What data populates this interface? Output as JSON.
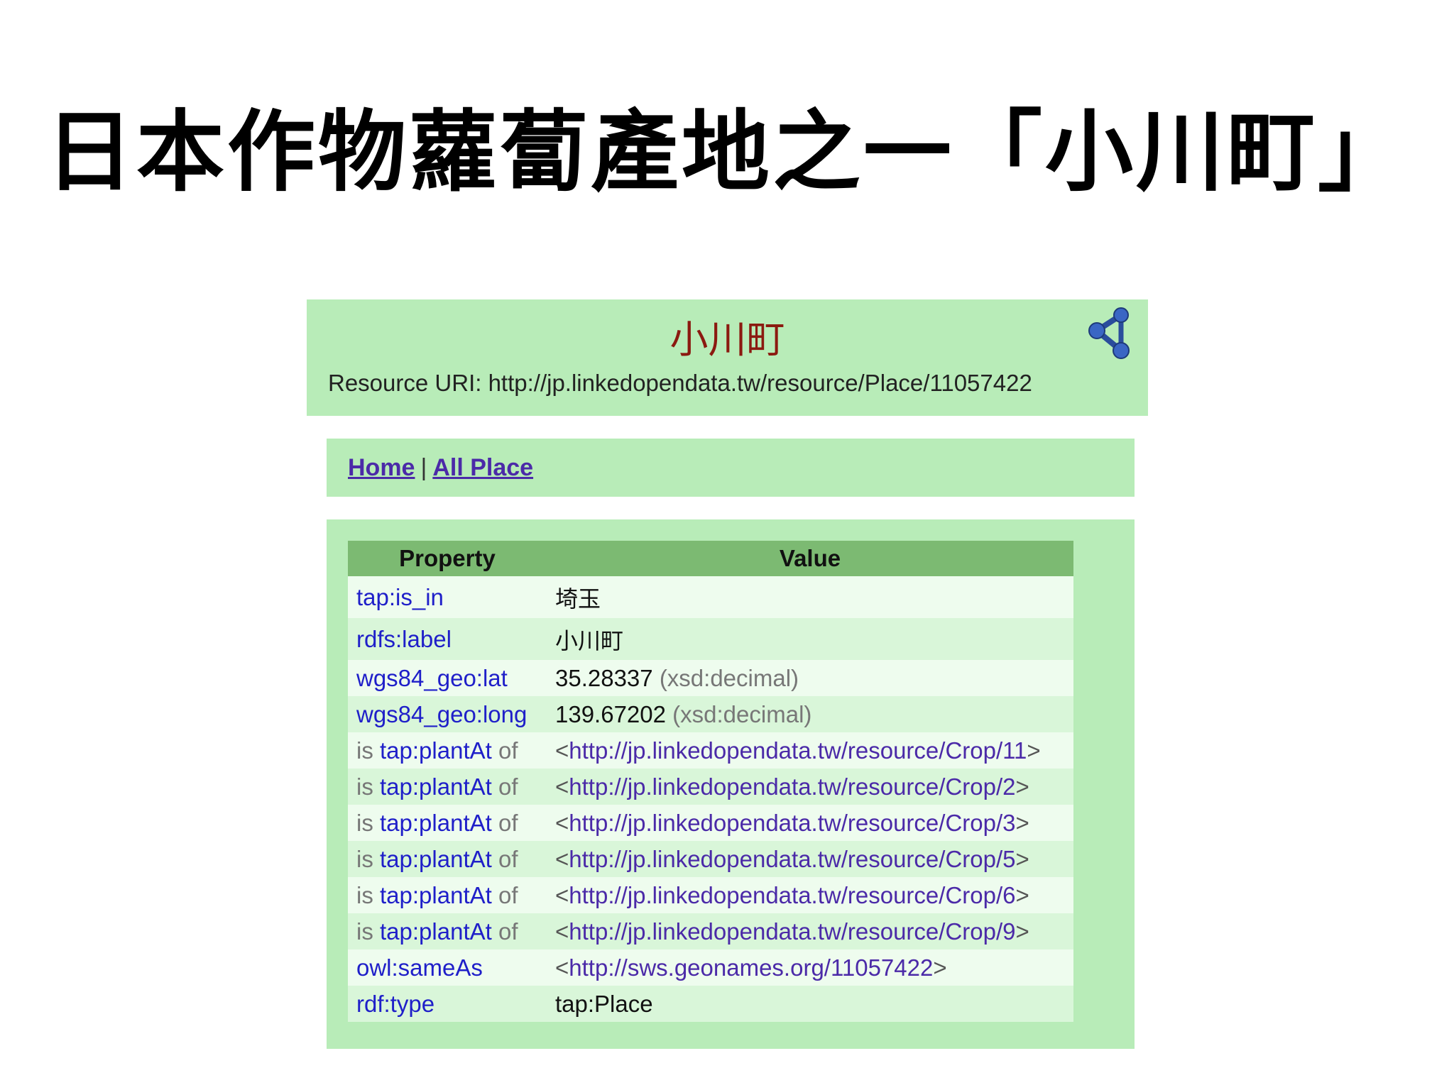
{
  "slide": {
    "title": "日本作物蘿蔔產地之一「小川町」"
  },
  "resource": {
    "title": "小川町",
    "uri_label": "Resource URI: http://jp.linkedopendata.tw/resource/Place/11057422",
    "share_icon": "share-icon"
  },
  "nav": {
    "home": "Home",
    "separator": "|",
    "all_place": "All Place"
  },
  "table": {
    "headers": {
      "property": "Property",
      "value": "Value"
    },
    "rows": [
      {
        "property": "tap:is_in",
        "value": "埼玉"
      },
      {
        "property": "rdfs:label",
        "value": "小川町"
      },
      {
        "property": "wgs84_geo:lat",
        "value": "35.28337",
        "datatype": "(xsd:decimal)"
      },
      {
        "property": "wgs84_geo:long",
        "value": "139.67202",
        "datatype": "(xsd:decimal)"
      },
      {
        "prefix": "is",
        "property": "tap:plantAt",
        "suffix": "of",
        "open": "<",
        "value": "http://jp.linkedopendata.tw/resource/Crop/11",
        "close": ">"
      },
      {
        "prefix": "is",
        "property": "tap:plantAt",
        "suffix": "of",
        "open": "<",
        "value": "http://jp.linkedopendata.tw/resource/Crop/2",
        "close": ">"
      },
      {
        "prefix": "is",
        "property": "tap:plantAt",
        "suffix": "of",
        "open": "<",
        "value": "http://jp.linkedopendata.tw/resource/Crop/3",
        "close": ">"
      },
      {
        "prefix": "is",
        "property": "tap:plantAt",
        "suffix": "of",
        "open": "<",
        "value": "http://jp.linkedopendata.tw/resource/Crop/5",
        "close": ">"
      },
      {
        "prefix": "is",
        "property": "tap:plantAt",
        "suffix": "of",
        "open": "<",
        "value": "http://jp.linkedopendata.tw/resource/Crop/6",
        "close": ">"
      },
      {
        "prefix": "is",
        "property": "tap:plantAt",
        "suffix": "of",
        "open": "<",
        "value": "http://jp.linkedopendata.tw/resource/Crop/9",
        "close": ">"
      },
      {
        "property": "owl:sameAs",
        "open": "<",
        "value": "http://sws.geonames.org/11057422",
        "close": ">"
      },
      {
        "property": "rdf:type",
        "value": "tap:Place"
      }
    ]
  },
  "colors": {
    "panel_green": "#b8ecb8",
    "header_green": "#7cba72",
    "title_red": "#8b1a10",
    "link_purple": "#4b2aa8",
    "property_blue": "#1f1fc9"
  }
}
